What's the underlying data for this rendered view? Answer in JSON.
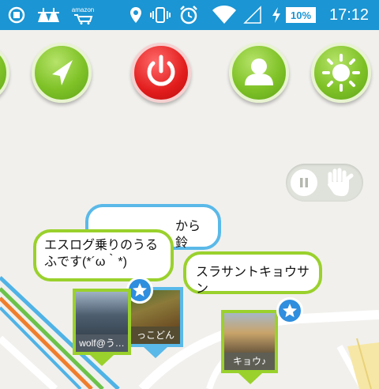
{
  "status_bar": {
    "battery": "10%",
    "time": "17:12",
    "store_label": "amazon",
    "icons": [
      "app-notify-icon",
      "cleaner-icon",
      "cleaner-icon",
      "amazon-cart-icon",
      "location-icon",
      "vibrate-icon",
      "alarm-icon",
      "wifi-icon",
      "signal-icon",
      "charging-icon"
    ]
  },
  "toolbar": {
    "buttons": [
      "navigate",
      "power",
      "profile",
      "brightness"
    ]
  },
  "toggle": {
    "left_icon": "pause-icon",
    "right_icon": "hand-icon"
  },
  "bubbles": {
    "behind": "から鈴",
    "front": "エスログ乗りのうるふです(*´ω｀*)",
    "right": "スラサントキョウサン"
  },
  "pins": {
    "a": "wolf@う…",
    "b": "っこどん",
    "c": "キョウ♪"
  },
  "colors": {
    "status_bar": "#1b95d3",
    "accent_green": "#7fc227",
    "power_red": "#e21c1c",
    "pin_blue": "#2f8ede"
  }
}
